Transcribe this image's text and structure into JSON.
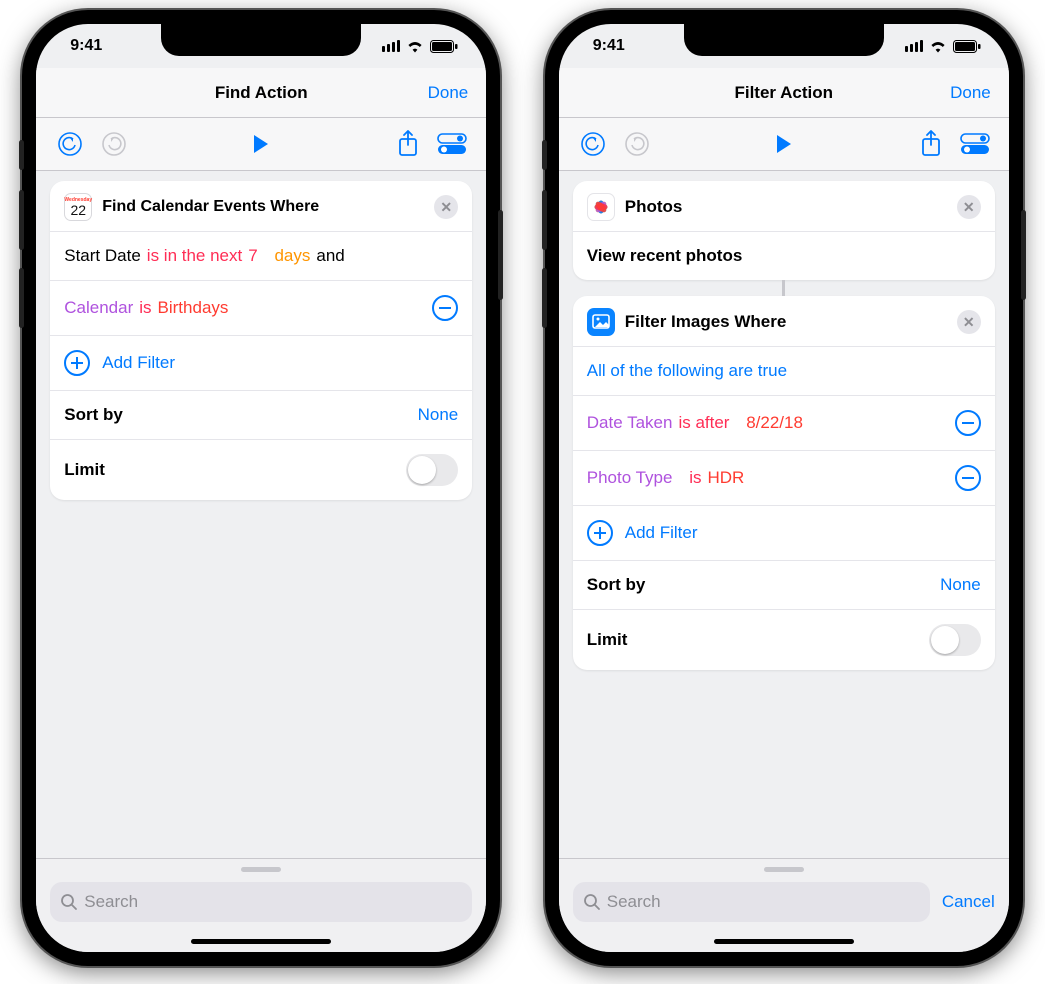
{
  "statusbar": {
    "time": "9:41"
  },
  "left_phone": {
    "nav": {
      "title": "Find Action",
      "done": "Done"
    },
    "card": {
      "title": "Find Calendar Events Where",
      "cal_day": "Wednesday",
      "cal_num": "22",
      "row1": {
        "f_field": "Start Date",
        "f_op": "is in the next",
        "f_num": "7",
        "f_unit": "days",
        "f_join": "and"
      },
      "row2": {
        "f_field": "Calendar",
        "f_op": "is",
        "f_val": "Birthdays"
      },
      "add_filter": "Add Filter",
      "sort_label": "Sort by",
      "sort_value": "None",
      "limit_label": "Limit"
    },
    "search": {
      "placeholder": "Search"
    }
  },
  "right_phone": {
    "nav": {
      "title": "Filter Action",
      "done": "Done"
    },
    "card_photos": {
      "title": "Photos",
      "desc": "View recent photos"
    },
    "card_filter": {
      "title": "Filter Images Where",
      "cond_group": "All of the following are true",
      "row1": {
        "f_field": "Date Taken",
        "f_op": "is after",
        "f_val": "8/22/18"
      },
      "row2": {
        "f_field": "Photo Type",
        "f_op": "is",
        "f_val": "HDR"
      },
      "add_filter": "Add Filter",
      "sort_label": "Sort by",
      "sort_value": "None",
      "limit_label": "Limit"
    },
    "search": {
      "placeholder": "Search",
      "cancel": "Cancel"
    }
  }
}
